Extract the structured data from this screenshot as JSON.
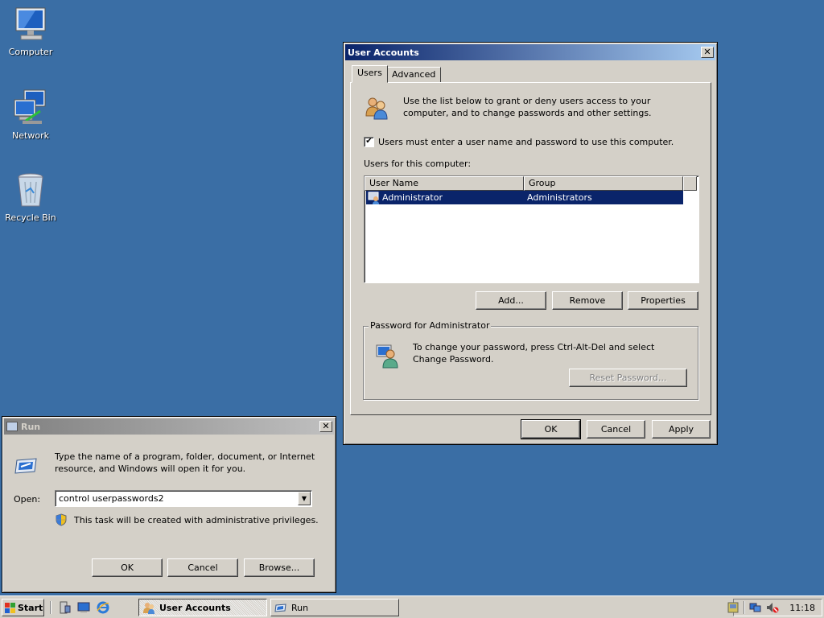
{
  "desktop": {
    "icons": [
      {
        "label": "Computer"
      },
      {
        "label": "Network"
      },
      {
        "label": "Recycle Bin"
      }
    ]
  },
  "user_accounts": {
    "title": "User Accounts",
    "tabs": [
      "Users",
      "Advanced"
    ],
    "intro": "Use the list below to grant or deny users access to your computer, and to change passwords and other settings.",
    "checkbox_label": "Users must enter a user name and password to use this computer.",
    "checkbox_checked": true,
    "list_label": "Users for this computer:",
    "columns": [
      "User Name",
      "Group"
    ],
    "rows": [
      {
        "user": "Administrator",
        "group": "Administrators",
        "selected": true
      }
    ],
    "buttons": {
      "add": "Add...",
      "remove": "Remove",
      "properties": "Properties"
    },
    "password_group": {
      "legend": "Password for Administrator",
      "text": "To change your password, press Ctrl-Alt-Del and select Change Password.",
      "reset_button": "Reset Password..."
    },
    "footer": {
      "ok": "OK",
      "cancel": "Cancel",
      "apply": "Apply"
    }
  },
  "run": {
    "title": "Run",
    "description": "Type the name of a program, folder, document, or Internet resource, and Windows will open it for you.",
    "open_label": "Open:",
    "open_value": "control userpasswords2",
    "admin_note": "This task will be created with administrative privileges.",
    "buttons": {
      "ok": "OK",
      "cancel": "Cancel",
      "browse": "Browse..."
    }
  },
  "taskbar": {
    "start": "Start",
    "tasks": [
      {
        "label": "User Accounts",
        "active": true
      },
      {
        "label": "Run",
        "active": false
      }
    ],
    "clock": "11:18"
  },
  "colors": {
    "desktop": "#3a6ea5",
    "title_active": "#0a246a",
    "selection": "#0a246a",
    "face": "#d4d0c8"
  }
}
